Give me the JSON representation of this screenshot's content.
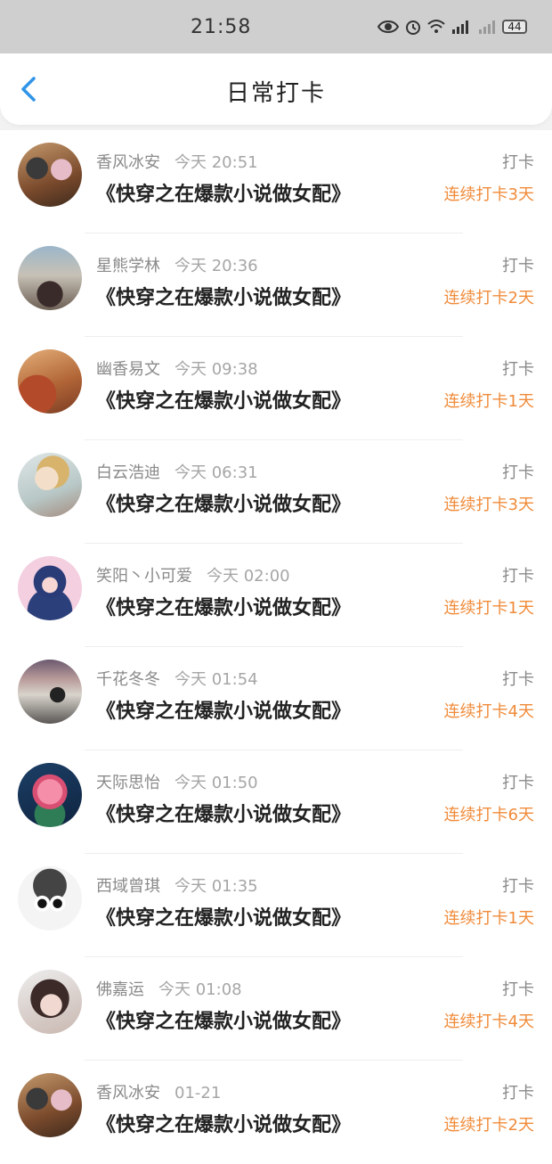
{
  "status_bar": {
    "time": "21:58",
    "battery": "44",
    "icons": [
      "eye-icon",
      "alarm-icon",
      "wifi-icon",
      "signal-5g-icon",
      "signal-icon"
    ]
  },
  "header": {
    "back_icon": "chevron-left-icon",
    "title": "日常打卡"
  },
  "colors": {
    "accent_back": "#2f94e8",
    "streak_orange": "#f08b3a"
  },
  "entries": [
    {
      "user": "香风冰安",
      "time": "今天 20:51",
      "book": "《快穿之在爆款小说做女配》",
      "action": "打卡",
      "streak": "连续打卡3天",
      "avatar": "couple-photo"
    },
    {
      "user": "星熊学林",
      "time": "今天 20:36",
      "book": "《快穿之在爆款小说做女配》",
      "action": "打卡",
      "streak": "连续打卡2天",
      "avatar": "seaside-person"
    },
    {
      "user": "幽香易文",
      "time": "今天 09:38",
      "book": "《快穿之在爆款小说做女配》",
      "action": "打卡",
      "streak": "连续打卡1天",
      "avatar": "autumn-trees"
    },
    {
      "user": "白云浩迪",
      "time": "今天 06:31",
      "book": "《快穿之在爆款小说做女配》",
      "action": "打卡",
      "streak": "连续打卡3天",
      "avatar": "girl-illustration"
    },
    {
      "user": "笑阳丶小可爱",
      "time": "今天 02:00",
      "book": "《快穿之在爆款小说做女配》",
      "action": "打卡",
      "streak": "连续打卡1天",
      "avatar": "anime-girl"
    },
    {
      "user": "千花冬冬",
      "time": "今天 01:54",
      "book": "《快穿之在爆款小说做女配》",
      "action": "打卡",
      "streak": "连续打卡4天",
      "avatar": "girl-balcony"
    },
    {
      "user": "天际思怡",
      "time": "今天 01:50",
      "book": "《快穿之在爆款小说做女配》",
      "action": "打卡",
      "streak": "连续打卡6天",
      "avatar": "pink-rose"
    },
    {
      "user": "西域曾琪",
      "time": "今天 01:35",
      "book": "《快穿之在爆款小说做女配》",
      "action": "打卡",
      "streak": "连续打卡1天",
      "avatar": "cartoon-face"
    },
    {
      "user": "佛嘉运",
      "time": "今天 01:08",
      "book": "《快穿之在爆款小说做女配》",
      "action": "打卡",
      "streak": "连续打卡4天",
      "avatar": "woman-portrait"
    },
    {
      "user": "香风冰安",
      "time": "01-21",
      "book": "《快穿之在爆款小说做女配》",
      "action": "打卡",
      "streak": "连续打卡2天",
      "avatar": "couple-photo"
    }
  ]
}
